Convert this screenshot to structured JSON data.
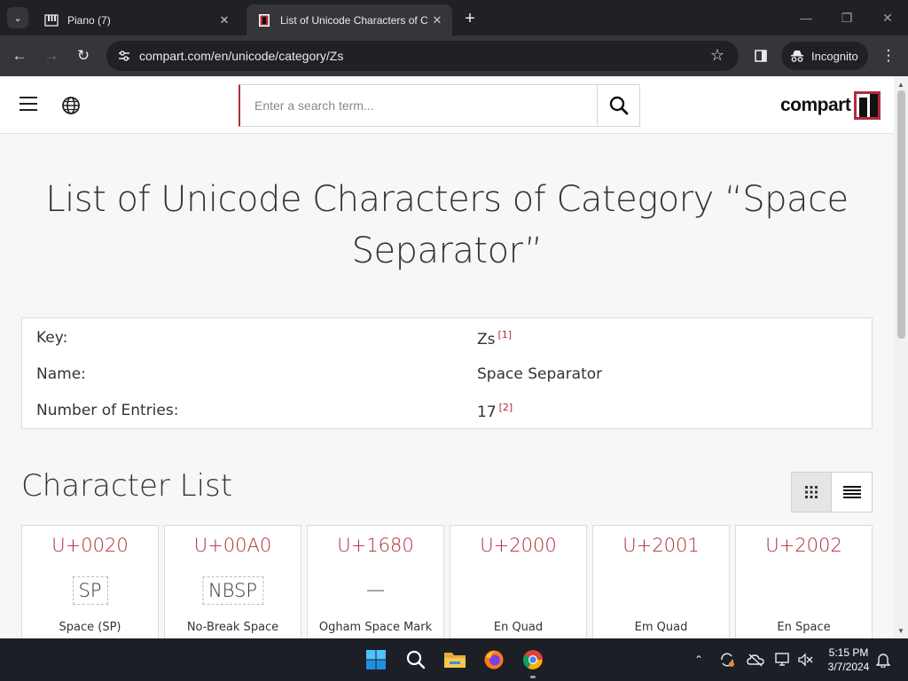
{
  "browser": {
    "tabs": [
      {
        "title": "Piano (7)",
        "active": false
      },
      {
        "title": "List of Unicode Characters of Ca",
        "active": true
      }
    ],
    "url": "compart.com/en/unicode/category/Zs",
    "profile_label": "Incognito"
  },
  "site": {
    "search_placeholder": "Enter a search term...",
    "logo_text": "compart",
    "accent_color": "#b02c3a"
  },
  "page": {
    "title": "List of Unicode Characters of Category “Space Separator”",
    "info": [
      {
        "key": "Key:",
        "value": "Zs",
        "note": "[1]"
      },
      {
        "key": "Name:",
        "value": "Space Separator",
        "note": ""
      },
      {
        "key": "Number of Entries:",
        "value": "17",
        "note": "[2]"
      }
    ],
    "section_title": "Character List",
    "characters": [
      {
        "code": "U+0020",
        "glyph": "SP",
        "boxed": true,
        "name": "Space (SP)"
      },
      {
        "code": "U+00A0",
        "glyph": "NBSP",
        "boxed": true,
        "name": "No-Break Space"
      },
      {
        "code": "U+1680",
        "glyph": "—",
        "boxed": false,
        "name": "Ogham Space Mark"
      },
      {
        "code": "U+2000",
        "glyph": "",
        "boxed": false,
        "name": "En Quad"
      },
      {
        "code": "U+2001",
        "glyph": "",
        "boxed": false,
        "name": "Em Quad"
      },
      {
        "code": "U+2002",
        "glyph": "",
        "boxed": false,
        "name": "En Space"
      }
    ]
  },
  "taskbar": {
    "time": "5:15 PM",
    "date": "3/7/2024"
  }
}
